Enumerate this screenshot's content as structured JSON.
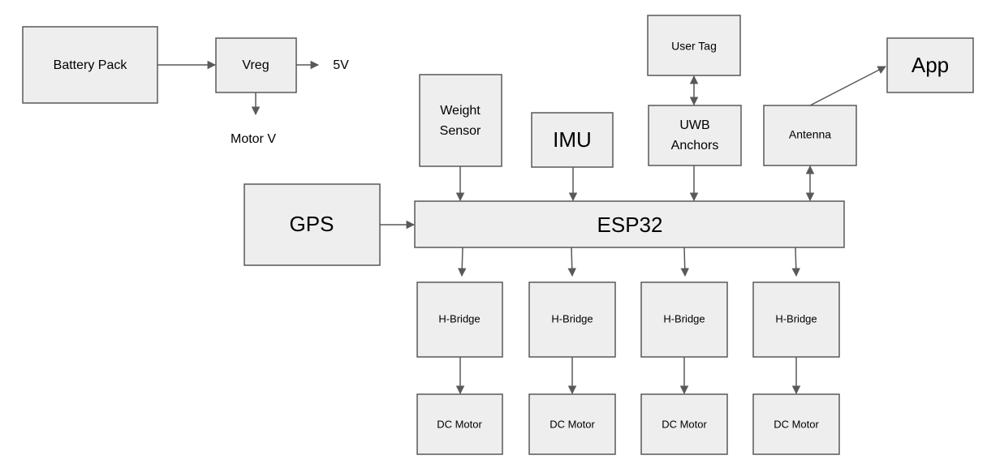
{
  "diagram": {
    "colors": {
      "box_fill": "#eeeeee",
      "stroke": "#595959"
    },
    "nodes": {
      "battery": "Battery Pack",
      "vreg": "Vreg",
      "out_5v": "5V",
      "motor_v": "Motor V",
      "weight_1": "Weight",
      "weight_2": "Sensor",
      "gps": "GPS",
      "esp32": "ESP32",
      "imu": "IMU",
      "user_tag": "User Tag",
      "uwb_1": "UWB",
      "uwb_2": "Anchors",
      "antenna": "Antenna",
      "app": "App",
      "hbridges": [
        "H-Bridge",
        "H-Bridge",
        "H-Bridge",
        "H-Bridge"
      ],
      "motors": [
        "DC Motor",
        "DC Motor",
        "DC Motor",
        "DC Motor"
      ]
    },
    "edges": [
      [
        "Battery Pack",
        "Vreg"
      ],
      [
        "Vreg",
        "5V"
      ],
      [
        "Vreg",
        "Motor V"
      ],
      [
        "Weight Sensor",
        "ESP32"
      ],
      [
        "IMU",
        "ESP32"
      ],
      [
        "UWB Anchors",
        "ESP32"
      ],
      [
        "User Tag",
        "UWB Anchors",
        "bidirectional"
      ],
      [
        "Antenna",
        "ESP32",
        "bidirectional"
      ],
      [
        "Antenna",
        "App"
      ],
      [
        "GPS",
        "ESP32"
      ],
      [
        "ESP32",
        "H-Bridge"
      ],
      [
        "H-Bridge",
        "DC Motor"
      ]
    ]
  }
}
